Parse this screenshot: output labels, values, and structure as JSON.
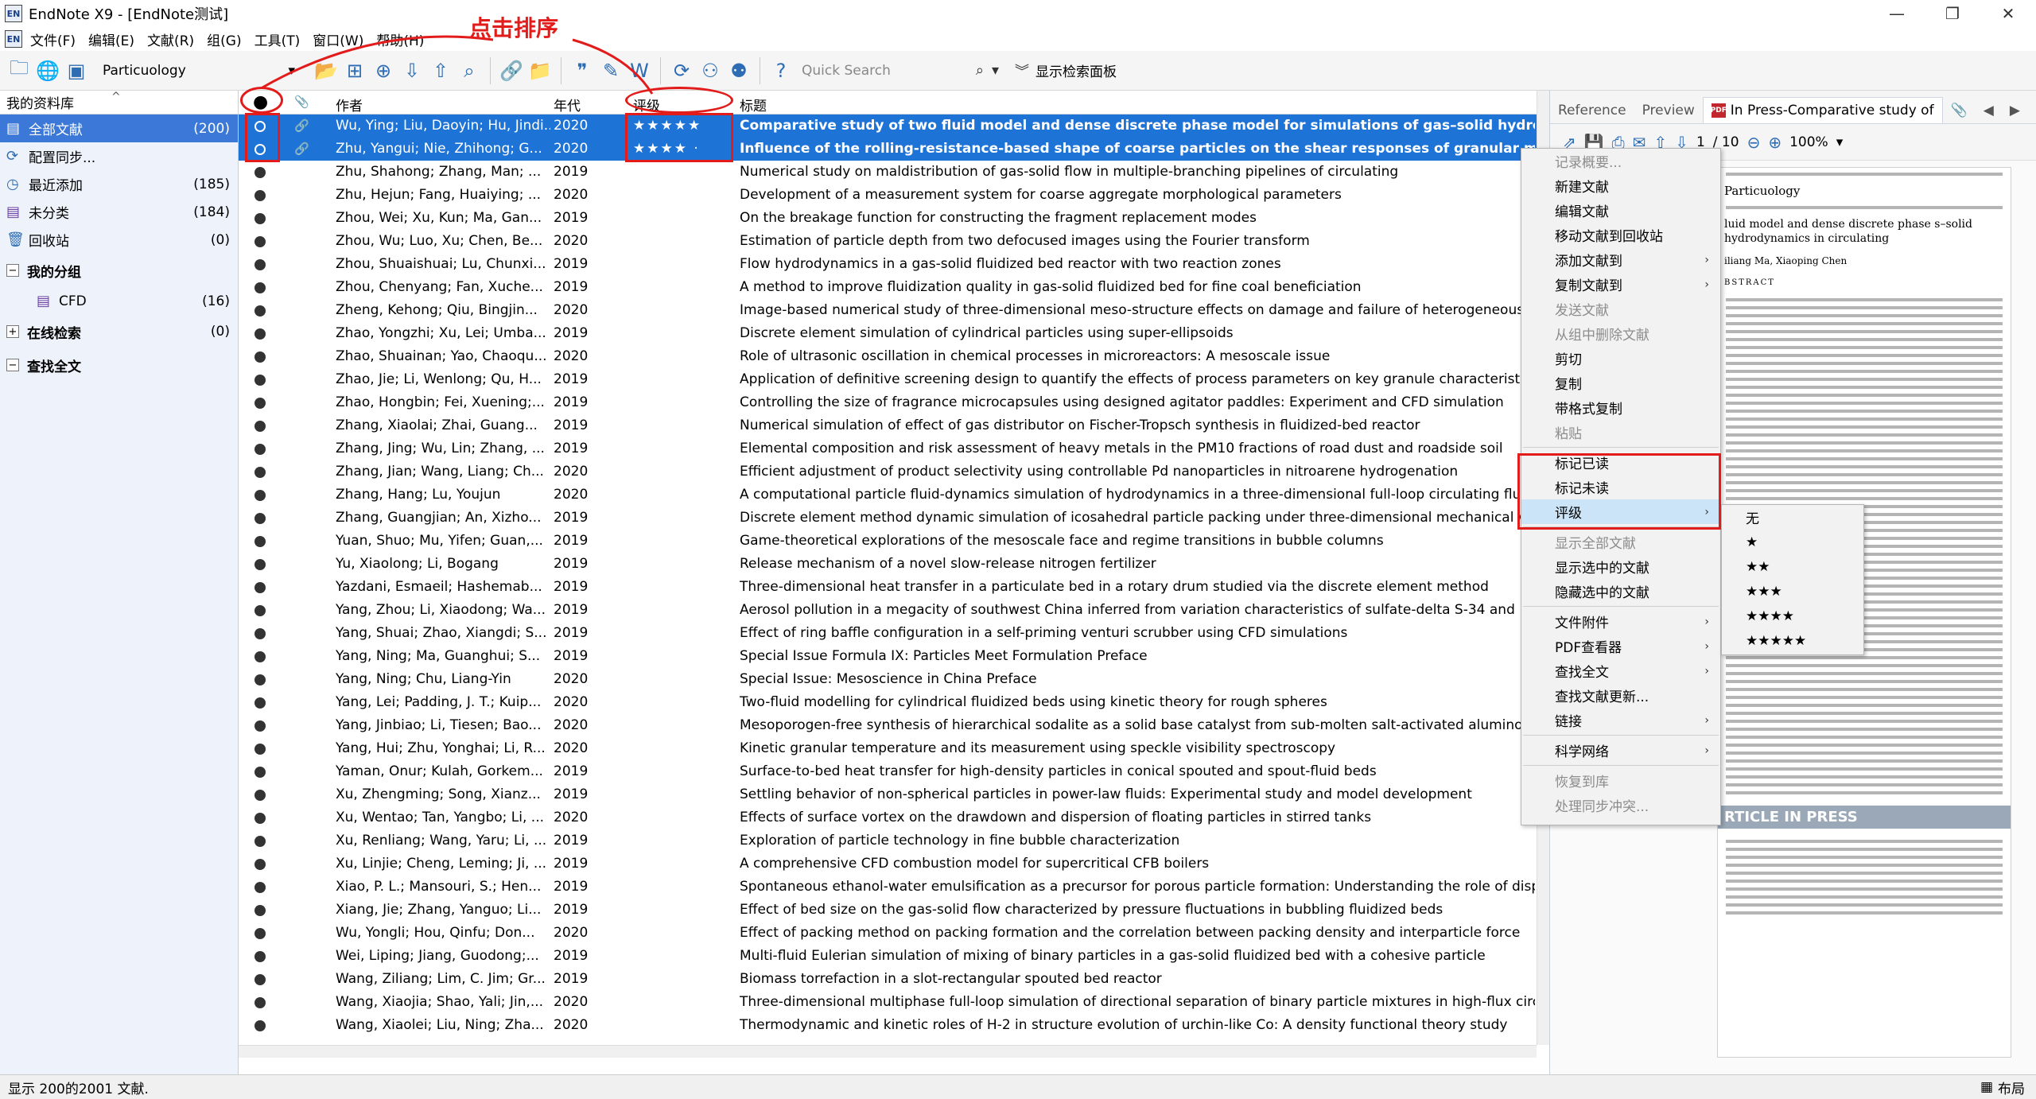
{
  "window": {
    "app_icon": "EN",
    "title": "EndNote X9 - [EndNote测试]",
    "minimize": "—",
    "restore": "❐",
    "close": "✕"
  },
  "menu": [
    {
      "name": "menu-file",
      "label": "文件(F)"
    },
    {
      "name": "menu-edit",
      "label": "编辑(E)"
    },
    {
      "name": "menu-references",
      "label": "文献(R)"
    },
    {
      "name": "menu-groups",
      "label": "组(G)"
    },
    {
      "name": "menu-tools",
      "label": "工具(T)"
    },
    {
      "name": "menu-window",
      "label": "窗口(W)"
    },
    {
      "name": "menu-help",
      "label": "帮助(H)"
    }
  ],
  "toolbar": {
    "style": "Particuology",
    "quick_search_placeholder": "Quick Search",
    "show_search_panel": "显示检索面板"
  },
  "left_panel": {
    "header": "我的资料库",
    "library_items": [
      {
        "label": "全部文献",
        "count": "(200)"
      },
      {
        "label": "配置同步...",
        "count": ""
      },
      {
        "label": "最近添加",
        "count": "(185)"
      },
      {
        "label": "未分类",
        "count": "(184)"
      },
      {
        "label": "回收站",
        "count": "(0)"
      }
    ],
    "my_groups": "我的分组",
    "group_cfd": {
      "label": "CFD",
      "count": "(16)"
    },
    "online_search": {
      "label": "在线检索",
      "count": "(0)"
    },
    "find_full_text": "查找全文"
  },
  "columns": {
    "author": "作者",
    "year": "年代",
    "rating": "评级",
    "title": "标题"
  },
  "references": [
    {
      "author": "Wu, Ying; Liu, Daoyin; Hu, Jindi...",
      "year": "2020",
      "rating": "★★★★★",
      "title": "Comparative study of two fluid model and dense discrete phase model for simulations of gas–solid hydrodynamics in circulating",
      "sel": true
    },
    {
      "author": "Zhu, Yangui; Nie, Zhihong; G...",
      "year": "2020",
      "rating": "★★★★ ·",
      "title": "Influence of the rolling-resistance-based shape of coarse particles on the shear responses of granular mixtures",
      "sel": true
    },
    {
      "author": "Zhu, Shahong; Zhang, Man; ...",
      "year": "2019",
      "rating": "",
      "title": "Numerical study on maldistribution of gas-solid flow in multiple-branching pipelines of circulating"
    },
    {
      "author": "Zhu, Hejun; Fang, Huaiying; ...",
      "year": "2020",
      "rating": "",
      "title": "Development of a measurement system for coarse aggregate morphological parameters"
    },
    {
      "author": "Zhou, Wei; Xu, Kun; Ma, Gan...",
      "year": "2019",
      "rating": "",
      "title": "On the breakage function for constructing the fragment replacement modes"
    },
    {
      "author": "Zhou, Wu; Luo, Xu; Chen, Be...",
      "year": "2020",
      "rating": "",
      "title": "Estimation of particle depth from two defocused images using the Fourier transform"
    },
    {
      "author": "Zhou, Shuaishuai; Lu, Chunxi...",
      "year": "2019",
      "rating": "",
      "title": "Flow hydrodynamics in a gas-solid fluidized bed reactor with two reaction zones"
    },
    {
      "author": "Zhou, Chenyang; Fan, Xuche...",
      "year": "2019",
      "rating": "",
      "title": "A method to improve fluidization quality in gas-solid fluidized bed for fine coal beneficiation"
    },
    {
      "author": "Zheng, Kehong; Qiu, Bingjin...",
      "year": "2020",
      "rating": "",
      "title": "Image-based numerical study of three-dimensional meso-structure effects on damage and failure of heterogeneous"
    },
    {
      "author": "Zhao, Yongzhi; Xu, Lei; Umba...",
      "year": "2019",
      "rating": "",
      "title": "Discrete element simulation of cylindrical particles using super-ellipsoids"
    },
    {
      "author": "Zhao, Shuainan; Yao, Chaoqu...",
      "year": "2020",
      "rating": "",
      "title": "Role of ultrasonic oscillation in chemical processes in microreactors: A mesoscale issue"
    },
    {
      "author": "Zhao, Jie; Li, Wenlong; Qu, H...",
      "year": "2019",
      "rating": "",
      "title": "Application of definitive screening design to quantify the effects of process parameters on key granule characteristics"
    },
    {
      "author": "Zhao, Hongbin; Fei, Xuening;...",
      "year": "2019",
      "rating": "",
      "title": "Controlling the size of fragrance microcapsules using designed agitator paddles: Experiment and CFD simulation"
    },
    {
      "author": "Zhang, Xiaolai; Zhai, Guang...",
      "year": "2019",
      "rating": "",
      "title": "Numerical simulation of effect of gas distributor on Fischer-Tropsch synthesis in fluidized-bed reactor"
    },
    {
      "author": "Zhang, Jing; Wu, Lin; Zhang, ...",
      "year": "2019",
      "rating": "",
      "title": "Elemental composition and risk assessment of heavy metals in the PM10 fractions of road dust and roadside soil"
    },
    {
      "author": "Zhang, Jian; Wang, Liang; Ch...",
      "year": "2020",
      "rating": "",
      "title": "Efficient adjustment of product selectivity using controllable Pd nanoparticles in nitroarene hydrogenation"
    },
    {
      "author": "Zhang, Hang; Lu, Youjun",
      "year": "2020",
      "rating": "",
      "title": "A computational particle fluid-dynamics simulation of hydrodynamics in a three-dimensional full-loop circulating fluidized"
    },
    {
      "author": "Zhang, Guangjian; An, Xizho...",
      "year": "2019",
      "rating": "",
      "title": "Discrete element method dynamic simulation of icosahedral particle packing under three-dimensional mechanical vibration"
    },
    {
      "author": "Yuan, Shuo; Mu, Yifen; Guan,...",
      "year": "2019",
      "rating": "",
      "title": "Game-theoretical explorations of the mesoscale face and regime transitions in bubble columns"
    },
    {
      "author": "Yu, Xiaolong; Li, Bogang",
      "year": "2019",
      "rating": "",
      "title": "Release mechanism of a novel slow-release nitrogen fertilizer"
    },
    {
      "author": "Yazdani, Esmaeil; Hashemab...",
      "year": "2019",
      "rating": "",
      "title": "Three-dimensional heat transfer in a particulate bed in a rotary drum studied via the discrete element method"
    },
    {
      "author": "Yang, Zhou; Li, Xiaodong; Wa...",
      "year": "2019",
      "rating": "",
      "title": "Aerosol pollution in a megacity of southwest China inferred from variation characteristics of sulfate-delta S-34 and"
    },
    {
      "author": "Yang, Shuai; Zhao, Xiangdi; S...",
      "year": "2019",
      "rating": "",
      "title": "Effect of ring baffle configuration in a self-priming venturi scrubber using CFD simulations"
    },
    {
      "author": "Yang, Ning; Ma, Guanghui; S...",
      "year": "2019",
      "rating": "",
      "title": "Special Issue Formula IX: Particles Meet Formulation Preface"
    },
    {
      "author": "Yang, Ning; Chu, Liang-Yin",
      "year": "2020",
      "rating": "",
      "title": "Special Issue: Mesoscience in China Preface"
    },
    {
      "author": "Yang, Lei; Padding, J. T.; Kuip...",
      "year": "2020",
      "rating": "",
      "title": "Two-fluid modelling for cylindrical fluidized beds using kinetic theory for rough spheres"
    },
    {
      "author": "Yang, Jinbiao; Li, Tiesen; Bao...",
      "year": "2020",
      "rating": "",
      "title": "Mesoporogen-free synthesis of hierarchical sodalite as a solid base catalyst from sub-molten salt-activated aluminosilicate"
    },
    {
      "author": "Yang, Hui; Zhu, Yonghai; Li, R...",
      "year": "2020",
      "rating": "",
      "title": "Kinetic granular temperature and its measurement using speckle visibility spectroscopy"
    },
    {
      "author": "Yaman, Onur; Kulah, Gorkem...",
      "year": "2019",
      "rating": "",
      "title": "Surface-to-bed heat transfer for high-density particles in conical spouted and spout-fluid beds"
    },
    {
      "author": "Xu, Zhengming; Song, Xianz...",
      "year": "2019",
      "rating": "",
      "title": "Settling behavior of non-spherical particles in power-law fluids: Experimental study and model development"
    },
    {
      "author": "Xu, Wentao; Tan, Yangbo; Li, ...",
      "year": "2020",
      "rating": "",
      "title": "Effects of surface vortex on the drawdown and dispersion of floating particles in stirred tanks"
    },
    {
      "author": "Xu, Renliang; Wang, Yaru; Li, ...",
      "year": "2019",
      "rating": "",
      "title": "Exploration of particle technology in fine bubble characterization"
    },
    {
      "author": "Xu, Linjie; Cheng, Leming; Ji, ...",
      "year": "2019",
      "rating": "",
      "title": "A comprehensive CFD combustion model for supercritical CFB boilers"
    },
    {
      "author": "Xiao, P. L.; Mansouri, S.; Hen...",
      "year": "2019",
      "rating": "",
      "title": "Spontaneous ethanol-water emulsification as a precursor for porous particle formation: Understanding the role of dispersion"
    },
    {
      "author": "Xiang, Jie; Zhang, Yanguo; Li...",
      "year": "2019",
      "rating": "",
      "title": "Effect of bed size on the gas-solid flow characterized by pressure fluctuations in bubbling fluidized beds"
    },
    {
      "author": "Wu, Yongli; Hou, Qinfu; Don...",
      "year": "2020",
      "rating": "",
      "title": "Effect of packing method on packing formation and the correlation between packing density and interparticle force"
    },
    {
      "author": "Wei, Liping; Jiang, Guodong;...",
      "year": "2019",
      "rating": "",
      "title": "Multi-fluid Eulerian simulation of mixing of binary particles in a gas-solid fluidized bed with a cohesive particle"
    },
    {
      "author": "Wang, Ziliang; Lim, C. Jim; Gr...",
      "year": "2019",
      "rating": "",
      "title": "Biomass torrefaction in a slot-rectangular spouted bed reactor"
    },
    {
      "author": "Wang, Xiaojia; Shao, Yali; Jin,...",
      "year": "2020",
      "rating": "",
      "title": "Three-dimensional multiphase full-loop simulation of directional separation of binary particle mixtures in high-flux circulating"
    },
    {
      "author": "Wang, Xiaolei; Liu, Ning; Zha...",
      "year": "2020",
      "rating": "",
      "title": "Thermodynamic and kinetic roles of H-2 in structure evolution of urchin-like Co: A density functional theory study"
    }
  ],
  "right_panel": {
    "tab_reference": "Reference",
    "tab_preview": "Preview",
    "tab_pdf": "In Press-Comparative study of",
    "page_num": "1",
    "page_total": "/ 10",
    "zoom": "100%",
    "pdf_journal": "Particuology",
    "pdf_title": "luid model and dense discrete phase s–solid hydrodynamics in circulating",
    "pdf_authors": "iliang Ma, Xiaoping Chen",
    "pdf_abstract": "BSTRACT",
    "pdf_banner": "RTICLE IN PRESS"
  },
  "context_menu": [
    {
      "label": "记录概要...",
      "dis": true
    },
    {
      "label": "新建文献"
    },
    {
      "label": "编辑文献"
    },
    {
      "label": "移动文献到回收站"
    },
    {
      "label": "添加文献到",
      "sub": true
    },
    {
      "label": "复制文献到",
      "sub": true
    },
    {
      "label": "发送文献",
      "dis": true
    },
    {
      "label": "从组中删除文献",
      "dis": true
    },
    {
      "label": "剪切"
    },
    {
      "label": "复制"
    },
    {
      "label": "带格式复制"
    },
    {
      "label": "粘贴",
      "dis": true
    },
    {
      "sep": true
    },
    {
      "label": "标记已读"
    },
    {
      "label": "标记未读"
    },
    {
      "label": "评级",
      "sub": true,
      "hl": true
    },
    {
      "sep": true
    },
    {
      "label": "显示全部文献",
      "dis": true
    },
    {
      "label": "显示选中的文献"
    },
    {
      "label": "隐藏选中的文献"
    },
    {
      "sep": true
    },
    {
      "label": "文件附件",
      "sub": true
    },
    {
      "label": "PDF查看器",
      "sub": true
    },
    {
      "label": "查找全文",
      "sub": true
    },
    {
      "label": "查找文献更新..."
    },
    {
      "label": "链接",
      "sub": true
    },
    {
      "sep": true
    },
    {
      "label": "科学网络",
      "sub": true
    },
    {
      "sep": true
    },
    {
      "label": "恢复到库",
      "dis": true
    },
    {
      "label": "处理同步冲突...",
      "dis": true
    }
  ],
  "rating_submenu": [
    "无",
    "★",
    "★★",
    "★★★",
    "★★★★",
    "★★★★★"
  ],
  "annotation_label": "点击排序",
  "status": {
    "text": "显示 200的2001 文献.",
    "layout": "布局"
  }
}
